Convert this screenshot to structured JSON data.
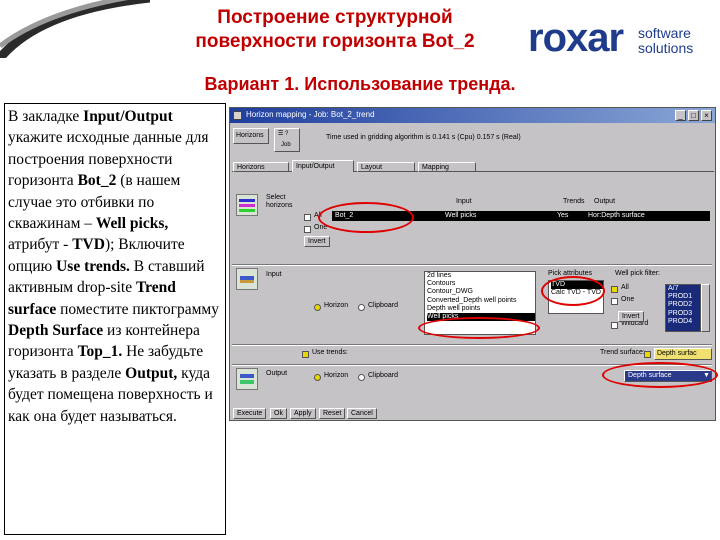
{
  "slide": {
    "title_line1": "Построение структурной",
    "title_line2": "поверхности горизонта Bot_2",
    "subtitle": "Вариант 1. Использование тренда.",
    "logo": {
      "word": "roxar",
      "sub_line1": "software",
      "sub_line2": "solutions"
    },
    "colors": {
      "title": "#c00000",
      "logo": "#1f3c8c",
      "highlight": "#e00000"
    }
  },
  "instructions": {
    "t1": "В закладке ",
    "b1": "Input/Output",
    "t2": " укажите исходные данные для построения поверхности горизонта ",
    "b2": "Bot_2",
    "t3": " (в нашем случае это отбивки по скважинам – ",
    "b3": "Well picks,",
    "t4": " атрибут - ",
    "b4": "TVD",
    "t5": "); Включите опцию ",
    "b5": "Use trends.",
    "t6": " В ставший активным drop-site ",
    "b6": "Trend surface",
    "t7": " поместите пиктограмму ",
    "b7": "Depth Surface",
    "t8": " из контейнера горизонта ",
    "b8": "Top_1.",
    "t9": " Не забудьте указать в разделе ",
    "b9": "Output,",
    "t10": " куда будет помещена поверхность и как она будет называться."
  },
  "window": {
    "title": "Horizon mapping - Job: Bot_2_trend",
    "toolbar": {
      "type_label": "Horizons",
      "job_label": "Job",
      "status_text": "Time used in gridding algorithm is 0.141 s (Cpu)  0.157 s (Real)"
    },
    "tabs": [
      "Horizons",
      "Input/Output",
      "Layout",
      "Mapping"
    ],
    "select_horizons": {
      "label_line1": "Select",
      "label_line2": "horizons",
      "all_label": "All",
      "one_label": "One",
      "invert_label": "Invert",
      "col_input": "Input",
      "col_trends": "Trends",
      "col_output": "Output",
      "row": {
        "horizon": "Bot_2",
        "input": "Well picks",
        "trends": "Yes",
        "output": "Hor:Depth surface"
      }
    },
    "input": {
      "label": "Input",
      "source_horizon": "Horizon",
      "source_clipboard": "Clipboard",
      "data_types": [
        "2d lines",
        "Contours",
        "Contour_DWG",
        "Converted_Depth well points",
        "Depth well points",
        "Well picks"
      ],
      "pick_attributes_label": "Pick attributes",
      "pick_attributes": [
        "TVD",
        "Calc TVD - TVD"
      ],
      "well_filter_label": "Well pick filter:",
      "filter_all": "All",
      "filter_one": "One",
      "filter_wildcard": "Wildcard",
      "filter_invert": "Invert",
      "wells": [
        "A/7",
        "PROD1",
        "PROD2",
        "PROD3",
        "PROD4"
      ]
    },
    "trends": {
      "use_trends_label": "Use trends:",
      "trend_surface_label": "Trend surface:",
      "trend_surface_value": "Depth surfac"
    },
    "output": {
      "label": "Output",
      "source_horizon": "Horizon",
      "source_clipboard": "Clipboard",
      "surface_value": "Depth surface"
    },
    "buttons": [
      "Execute",
      "Ok",
      "Apply",
      "Reset",
      "Cancel"
    ]
  }
}
